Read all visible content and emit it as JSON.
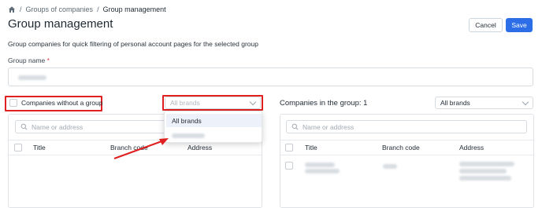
{
  "breadcrumb": {
    "home_icon": "home-icon",
    "separator": "/",
    "items": [
      "Groups of companies",
      "Group management"
    ]
  },
  "page": {
    "title": "Group management",
    "description": "Group companies for quick filtering of personal account pages for the selected group"
  },
  "actions": {
    "cancel_label": "Cancel",
    "save_label": "Save"
  },
  "group_name": {
    "label": "Group name",
    "required_marker": "*"
  },
  "left_panel": {
    "checkbox_label": "Companies without a group",
    "brand_select": {
      "placeholder": "All brands"
    },
    "search_placeholder": "Name or address",
    "columns": [
      "Title",
      "Branch code",
      "Address"
    ]
  },
  "dropdown": {
    "options": [
      "All brands"
    ]
  },
  "right_panel": {
    "heading": "Companies in the group: 1",
    "brand_select_value": "All brands",
    "search_placeholder": "Name or address",
    "columns": [
      "Title",
      "Branch code",
      "Address"
    ]
  },
  "colors": {
    "accent": "#2d6ee8",
    "highlight": "#e02020",
    "required": "#e0393e"
  }
}
